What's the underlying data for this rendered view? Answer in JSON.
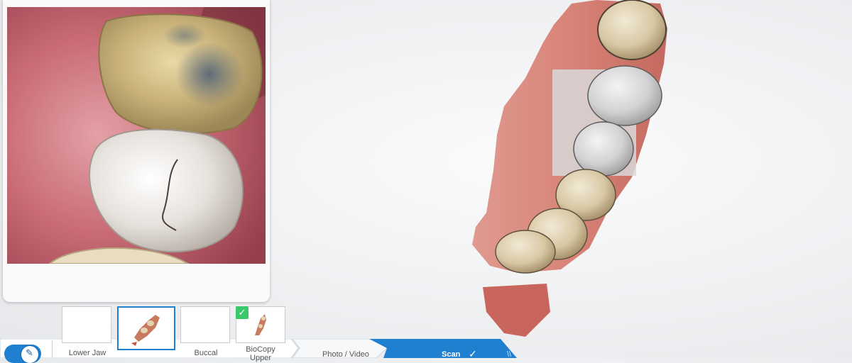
{
  "workflow": {
    "thumbnails": [
      {
        "label": "Lower Jaw",
        "state": "empty",
        "selected": false
      },
      {
        "label": "",
        "state": "scan",
        "selected": true
      },
      {
        "label": "Buccal",
        "state": "empty",
        "selected": false
      },
      {
        "label": "BioCopy\nUpper",
        "state": "scan",
        "checked": true,
        "selected": false
      }
    ],
    "check_mark": "✓",
    "steps": {
      "photo_video": "Photo / Video",
      "scan": "Scan",
      "scan_mark": "✓",
      "more": "\\\\"
    }
  },
  "colors": {
    "accent": "#1f7fd0",
    "check": "#3cc76a"
  },
  "icons": {
    "toggle": "scanner-icon",
    "check": "check-icon"
  }
}
